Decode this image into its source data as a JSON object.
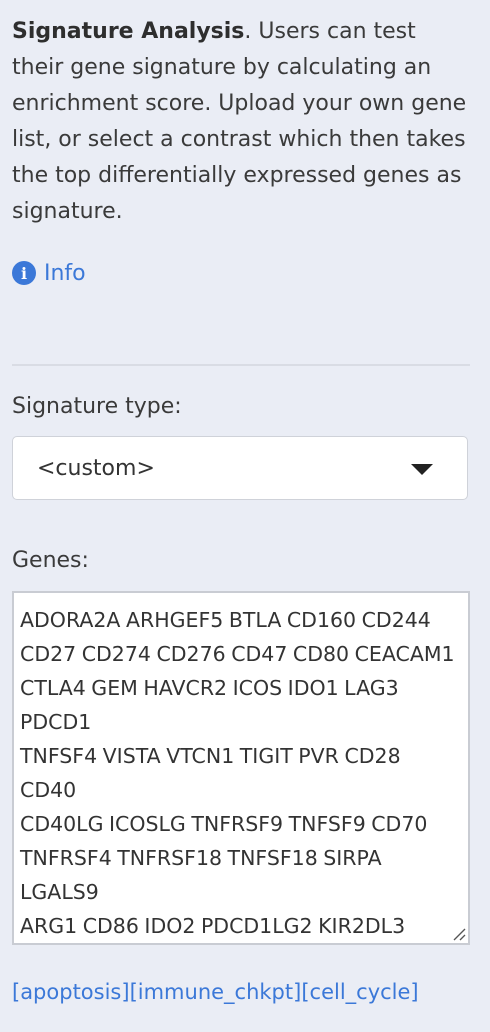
{
  "intro": {
    "title": "Signature Analysis",
    "text": ". Users can test their gene signature by calculating an enrichment score. Upload your own gene list, or select a contrast which then takes the top differentially expressed genes as signature."
  },
  "info": {
    "icon": "info-circle-icon",
    "icon_glyph": "i",
    "label": "Info"
  },
  "signature_type": {
    "label": "Signature type:",
    "selected": "<custom>"
  },
  "genes": {
    "label": "Genes:",
    "lines": [
      "ADORA2A ARHGEF5 BTLA CD160 CD244",
      "CD27 CD274 CD276 CD47 CD80 CEACAM1",
      "CTLA4 GEM HAVCR2 ICOS IDO1 LAG3 PDCD1",
      "TNFSF4 VISTA VTCN1 TIGIT PVR CD28 CD40",
      "CD40LG ICOSLG TNFRSF9 TNFSF9 CD70",
      "TNFRSF4 TNFRSF18 TNFSF18 SIRPA LGALS9",
      "ARG1 CD86 IDO2 PDCD1LG2 KIR2DL3"
    ]
  },
  "example_links": [
    "[apoptosis]",
    "[immune_chkpt]",
    "[cell_cycle]"
  ],
  "colors": {
    "background": "#eaedf5",
    "link": "#3b78d8"
  }
}
